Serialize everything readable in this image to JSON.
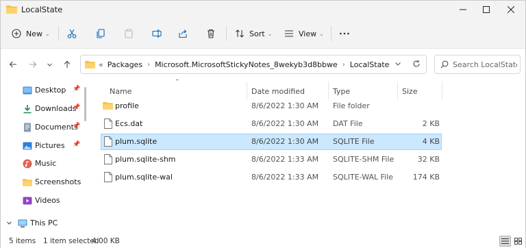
{
  "window": {
    "title": "LocalState",
    "icons": {
      "app": "folder-icon",
      "minimize": "minimize-icon",
      "maximize": "maximize-icon",
      "close": "close-icon"
    }
  },
  "toolbar": {
    "new_label": "New",
    "sort_label": "Sort",
    "view_label": "View",
    "icons": [
      "new-icon",
      "cut-icon",
      "copy-icon",
      "paste-icon",
      "rename-icon",
      "share-icon",
      "delete-icon",
      "sort-icon",
      "view-icon",
      "more-icon"
    ]
  },
  "address": {
    "overflow": "«",
    "crumbs": [
      "Packages",
      "Microsoft.MicrosoftStickyNotes_8wekyb3d8bbwe",
      "LocalState"
    ]
  },
  "search": {
    "placeholder": "Search LocalState"
  },
  "nav": {
    "items": [
      {
        "label": "Desktop",
        "icon": "desktop-icon",
        "pinned": true
      },
      {
        "label": "Downloads",
        "icon": "downloads-icon",
        "pinned": true
      },
      {
        "label": "Documents",
        "icon": "documents-icon",
        "pinned": true
      },
      {
        "label": "Pictures",
        "icon": "pictures-icon",
        "pinned": true
      },
      {
        "label": "Music",
        "icon": "music-icon",
        "pinned": false
      },
      {
        "label": "Screenshots",
        "icon": "folder-icon",
        "pinned": false
      },
      {
        "label": "Videos",
        "icon": "videos-icon",
        "pinned": false
      }
    ],
    "this_pc": "This PC"
  },
  "columns": {
    "name": "Name",
    "date": "Date modified",
    "type": "Type",
    "size": "Size"
  },
  "files": [
    {
      "name": "profile",
      "date": "8/6/2022 1:30 AM",
      "type": "File folder",
      "size": "",
      "icon": "folder-icon",
      "selected": false
    },
    {
      "name": "Ecs.dat",
      "date": "8/6/2022 1:30 AM",
      "type": "DAT File",
      "size": "2 KB",
      "icon": "file-icon",
      "selected": false
    },
    {
      "name": "plum.sqlite",
      "date": "8/6/2022 1:30 AM",
      "type": "SQLITE File",
      "size": "4 KB",
      "icon": "file-icon",
      "selected": true
    },
    {
      "name": "plum.sqlite-shm",
      "date": "8/6/2022 1:33 AM",
      "type": "SQLITE-SHM File",
      "size": "32 KB",
      "icon": "file-icon",
      "selected": false
    },
    {
      "name": "plum.sqlite-wal",
      "date": "8/6/2022 1:33 AM",
      "type": "SQLITE-WAL File",
      "size": "174 KB",
      "icon": "file-icon",
      "selected": false
    }
  ],
  "status": {
    "items": "5 items",
    "selected": "1 item selected",
    "size": "4.00 KB"
  },
  "colors": {
    "selection": "#cce8ff",
    "selection_border": "#99d1ff",
    "folder": "#f4c04e",
    "accent": "#0067c0"
  }
}
